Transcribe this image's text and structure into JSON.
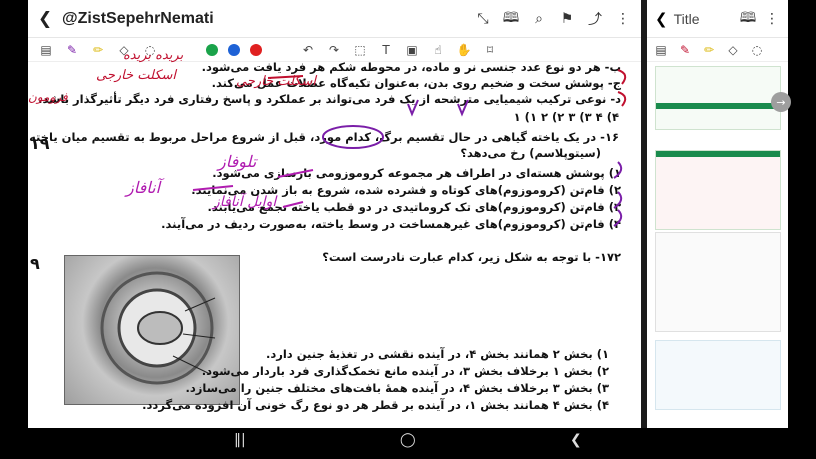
{
  "left_pane": {
    "header": {
      "title": "@ZistSepehrNemati",
      "icons": [
        "back-icon",
        "expand-icon",
        "book-icon",
        "search-icon",
        "bookmark-icon",
        "share-icon",
        "more-icon"
      ]
    },
    "toolbar": {
      "icons": [
        "sidebar-icon",
        "pen-icon",
        "highlighter-icon",
        "eraser-icon",
        "lasso-icon"
      ],
      "colors": [
        "#1aa34a",
        "#1e62d6",
        "#e02020"
      ],
      "icons_after": [
        "undo-icon",
        "redo-icon",
        "shape-icon",
        "text-icon",
        "image-icon",
        "pointer-icon",
        "hand-icon",
        "tag-icon"
      ]
    },
    "document": {
      "lines": {
        "b_top": "ب- هر دو نوع عدد جنسی نر و ماده، در محوطه شکم هر فرد یافت می‌شود.",
        "j": "ج- پوشش سخت و ضخیم روی بدن، به‌عنوان تکیه‌گاه عضلات عمل می‌کند.",
        "d": "د- نوعی ترکیب شیمیایی مترشحه از یک فرد می‌تواند بر عملکرد و پاسخ رفتاری فرد دیگر تأثیرگذار باشد.",
        "num_row": "۴) ۴        ۳) ۳        ۲) ۲        ۱) ۱",
        "q16_line1": "۱۶- در یک یاخته گیاهی در حال تقسیم برگ، کدام مورد، قبل از شروع مراحل مربوط به تقسیم میان یاخته",
        "q16_line2": "(سیتوپلاسم) رخ می‌دهد؟",
        "o1": "۱) پوشش هسته‌ای در اطراف هر مجموعه کروموزومی بازسازی می‌شود.",
        "o2": "۲) فام‌تن (کروموزوم)های کوتاه و فشرده شده، شروع به باز شدن می‌نمایند.",
        "o3": "۳) فام‌تن (کروموزوم)های تک کروماتیدی در دو قطب یاخته تجمع می‌یابند.",
        "o4": "۴) فام‌تن (کروموزوم)های غیرهمساخت در وسط یاخته، به‌صورت ردیف در می‌آیند.",
        "q172": "۱۷۲- با توجه به شکل زیر، کدام عبارت نادرست است؟",
        "p1": "۱) بخش ۲ همانند بخش ۴، در آینده نقشی در تغذیهٔ جنین دارد.",
        "p2": "۲) بخش ۱ برخلاف بخش ۳، در آینده مانع تخمک‌گذاری فرد باردار می‌شود.",
        "p3": "۳) بخش ۳ برخلاف بخش ۴، در آینده همهٔ بافت‌های مختلف جنین را می‌سازد.",
        "p4": "۴) بخش ۴ همانند بخش ۱، در آینده بر قطر هر دو نوع رگ خونی آن افزوده می‌گردد."
      },
      "margin_numbers": [
        "۱۹",
        "۹"
      ],
      "handwriting": {
        "top_right_1": "بریده بریده",
        "top_right_2": "اسکلت خارجی",
        "top_left_1": "اسکلت خارجی",
        "chromosome": "فرومون",
        "telophase": "تلوفاز",
        "anaphase": "آنافاز",
        "metaphase": "اوایل آنافاز"
      }
    }
  },
  "right_pane": {
    "header": {
      "title": "Title",
      "icons": [
        "back-icon",
        "book-icon",
        "more-icon"
      ]
    },
    "toolbar": {
      "icons": [
        "sidebar-icon",
        "pen-icon",
        "highlighter-icon",
        "eraser-icon",
        "lasso-icon"
      ]
    }
  },
  "colors": {
    "ink_red": "#c0102f",
    "ink_magenta": "#b01cb0",
    "ink_purple": "#7a1ea8",
    "accent_green": "#1a8b4d"
  },
  "navbar": {
    "icons": [
      "recent-apps-icon",
      "home-icon",
      "back-nav-icon"
    ]
  }
}
